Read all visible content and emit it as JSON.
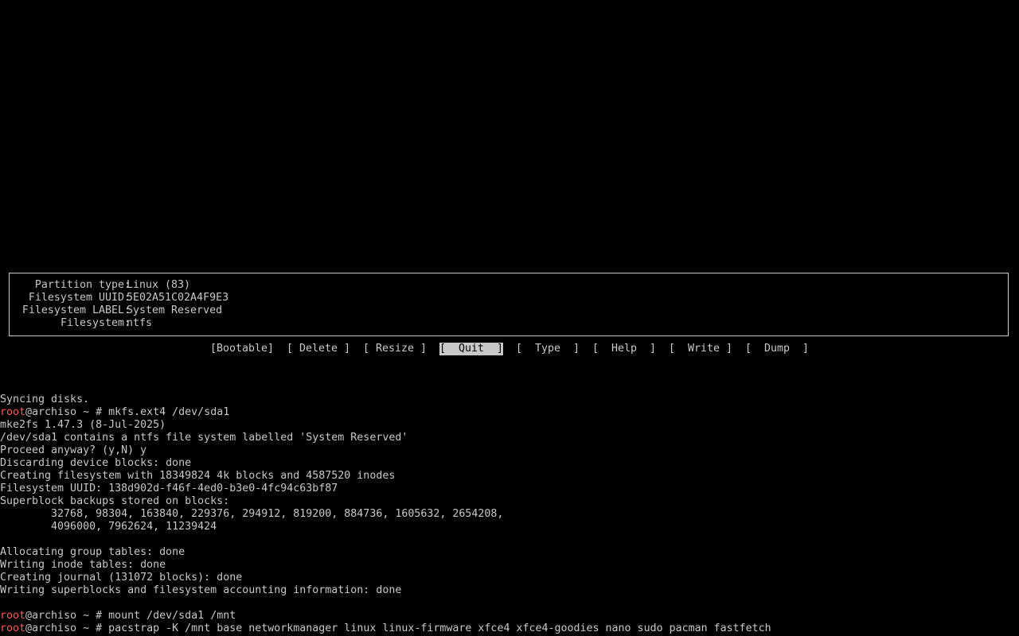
{
  "partition_info": {
    "rows": [
      {
        "label": "Partition type:",
        "value": "Linux (83)"
      },
      {
        "label": "Filesystem UUID:",
        "value": "5E02A51C02A4F9E3"
      },
      {
        "label": "Filesystem LABEL:",
        "value": "System Reserved"
      },
      {
        "label": "Filesystem:",
        "value": "ntfs"
      }
    ]
  },
  "menu": {
    "items": [
      {
        "label": "[Bootable]",
        "selected": false
      },
      {
        "label": "[ Delete ]",
        "selected": false
      },
      {
        "label": "[ Resize ]",
        "selected": false
      },
      {
        "label": "[  Quit  ]",
        "selected": true
      },
      {
        "label": "[  Type  ]",
        "selected": false
      },
      {
        "label": "[  Help  ]",
        "selected": false
      },
      {
        "label": "[  Write ]",
        "selected": false
      },
      {
        "label": "[  Dump  ]",
        "selected": false
      }
    ]
  },
  "terminal": {
    "prompt_user": "root",
    "prompt_rest": "@archiso ~ # ",
    "lines": [
      {
        "type": "text",
        "text": "Syncing disks."
      },
      {
        "type": "prompt",
        "text": "mkfs.ext4 /dev/sda1"
      },
      {
        "type": "text",
        "text": "mke2fs 1.47.3 (8-Jul-2025)"
      },
      {
        "type": "text",
        "text": "/dev/sda1 contains a ntfs file system labelled 'System Reserved'"
      },
      {
        "type": "text",
        "text": "Proceed anyway? (y,N) y"
      },
      {
        "type": "text",
        "text": "Discarding device blocks: done"
      },
      {
        "type": "text",
        "text": "Creating filesystem with 18349824 4k blocks and 4587520 inodes"
      },
      {
        "type": "text",
        "text": "Filesystem UUID: 138d902d-f46f-4ed0-b3e0-4fc94c63bf87"
      },
      {
        "type": "text",
        "text": "Superblock backups stored on blocks:"
      },
      {
        "type": "text",
        "text": "        32768, 98304, 163840, 229376, 294912, 819200, 884736, 1605632, 2654208,"
      },
      {
        "type": "text",
        "text": "        4096000, 7962624, 11239424"
      },
      {
        "type": "text",
        "text": ""
      },
      {
        "type": "text",
        "text": "Allocating group tables: done"
      },
      {
        "type": "text",
        "text": "Writing inode tables: done"
      },
      {
        "type": "text",
        "text": "Creating journal (131072 blocks): done"
      },
      {
        "type": "text",
        "text": "Writing superblocks and filesystem accounting information: done"
      },
      {
        "type": "text",
        "text": ""
      },
      {
        "type": "prompt",
        "text": "mount /dev/sda1 /mnt"
      },
      {
        "type": "prompt",
        "text": "pacstrap -K /mnt base networkmanager linux linux-firmware xfce4 xfce4-goodies nano sudo pacman fastfetch"
      }
    ]
  },
  "colors": {
    "background": "#000000",
    "foreground": "#c8c8c8",
    "prompt_user": "#ff5555",
    "selection_bg": "#c8c8c8",
    "selection_fg": "#000000"
  }
}
